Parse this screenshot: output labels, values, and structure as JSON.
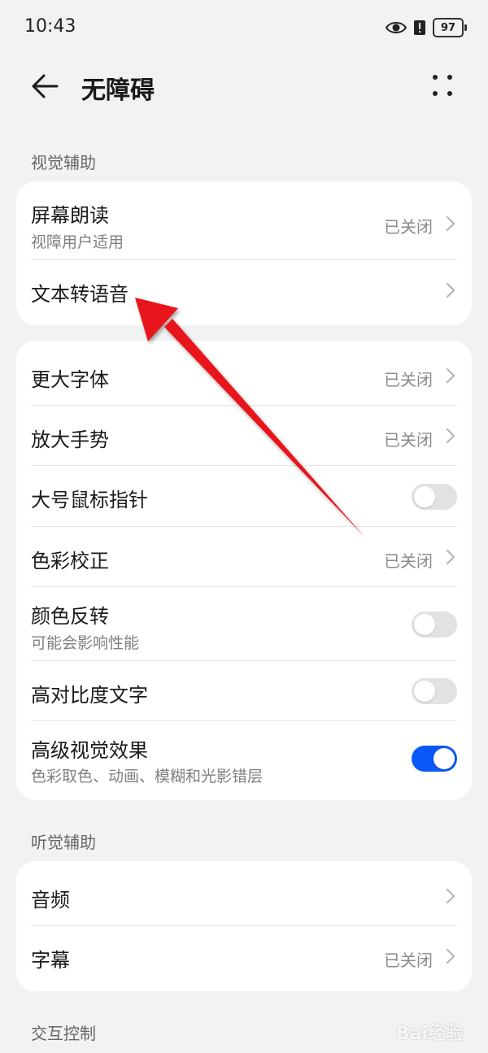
{
  "status_bar": {
    "time": "10:43",
    "battery": "97"
  },
  "header": {
    "title": "无障碍"
  },
  "sections": {
    "visual": "视觉辅助",
    "hearing": "听觉辅助",
    "interaction": "交互控制"
  },
  "group1": [
    {
      "label": "屏幕朗读",
      "sub": "视障用户适用",
      "value": "已关闭"
    },
    {
      "label": "文本转语音"
    }
  ],
  "group2": [
    {
      "label": "更大字体",
      "value": "已关闭"
    },
    {
      "label": "放大手势",
      "value": "已关闭"
    },
    {
      "label": "大号鼠标指针",
      "toggle": false
    },
    {
      "label": "色彩校正",
      "value": "已关闭"
    },
    {
      "label": "颜色反转",
      "sub": "可能会影响性能",
      "toggle": false
    },
    {
      "label": "高对比度文字",
      "toggle": false
    },
    {
      "label": "高级视觉效果",
      "sub": "色彩取色、动画、模糊和光影错层",
      "toggle": true
    }
  ],
  "group3": [
    {
      "label": "音频"
    },
    {
      "label": "字幕",
      "value": "已关闭"
    }
  ],
  "colors": {
    "accent": "#0a59f7",
    "annotation_arrow": "#e8141c"
  },
  "watermark": "Bai经验"
}
